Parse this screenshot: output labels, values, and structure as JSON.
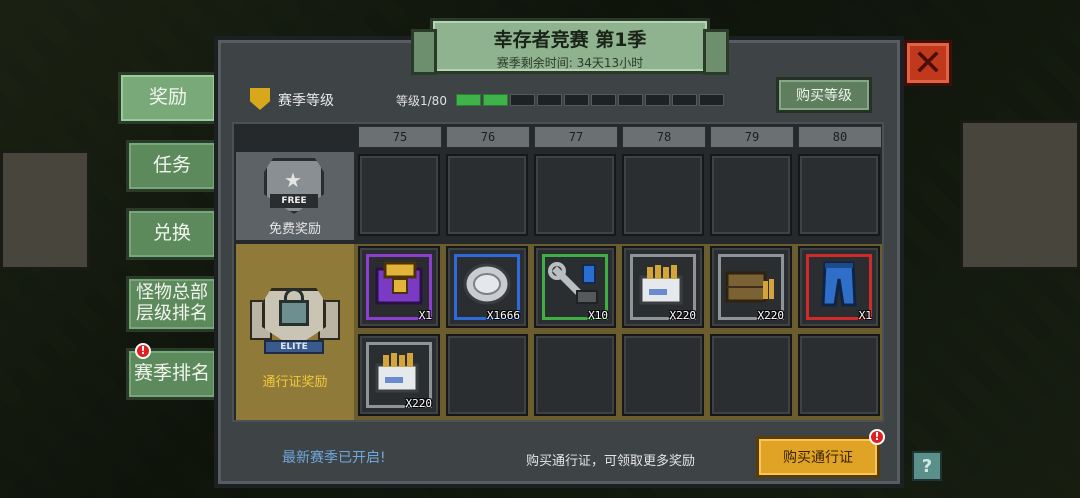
{
  "title": {
    "main": "幸存者竞赛 第1季",
    "sub": "赛季剩余时间: 34天13小时"
  },
  "close_icon": "close-icon",
  "side_tabs": [
    {
      "label": "奖励",
      "active": true
    },
    {
      "label": "任务",
      "active": false
    },
    {
      "label": "兑换",
      "active": false
    },
    {
      "label": "怪物总部\n层级排名",
      "active": false
    },
    {
      "label": "赛季排名",
      "active": false,
      "badge": "!"
    }
  ],
  "season": {
    "label": "赛季等级",
    "level_text": "等级1/80",
    "level_current": 1,
    "level_max": 80,
    "buy_level_label": "购买等级"
  },
  "columns": [
    "75",
    "76",
    "77",
    "78",
    "79",
    "80"
  ],
  "free_row": {
    "badge_text": "FREE",
    "label": "免费奖励"
  },
  "elite_row": {
    "badge_text": "ELITE",
    "label": "通行证奖励"
  },
  "elite_items": [
    {
      "icon": "purple-crate-icon",
      "qty": "X1"
    },
    {
      "icon": "silver-coin-icon",
      "qty": "X1666"
    },
    {
      "icon": "wrench-parts-icon",
      "qty": "X10"
    },
    {
      "icon": "ammo-box-white-icon",
      "qty": "X220"
    },
    {
      "icon": "ammo-crate-wood-icon",
      "qty": "X220"
    },
    {
      "icon": "blue-jeans-icon",
      "qty": "X1"
    },
    {
      "icon": "ammo-box-white-icon",
      "qty": "X220"
    }
  ],
  "footer": {
    "new_season": "最新赛季已开启!",
    "hint": "购买通行证，可领取更多奖励",
    "buy_pass_label": "购买通行证",
    "buy_pass_badge": "!"
  },
  "help_label": "?"
}
